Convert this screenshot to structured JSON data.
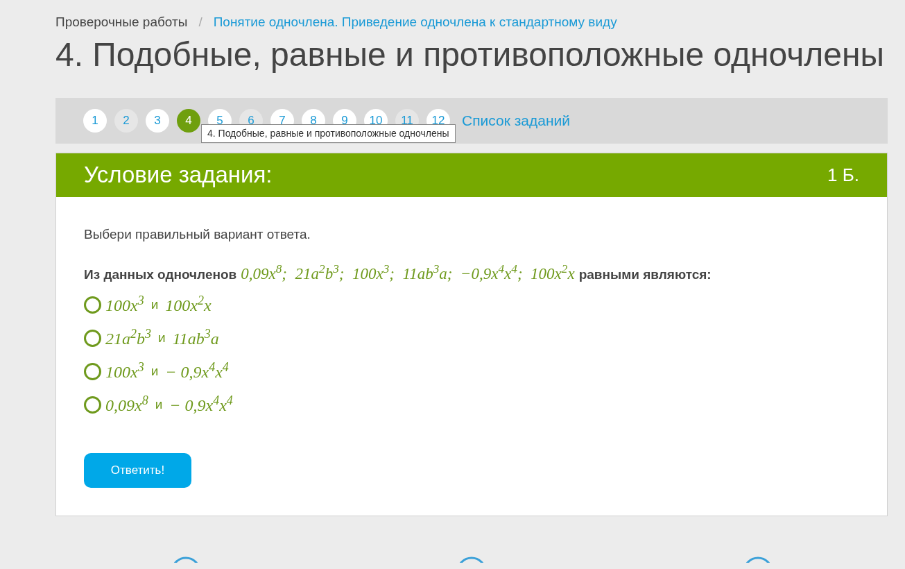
{
  "breadcrumb": [
    {
      "label": "Проверочные работы",
      "link": false
    },
    {
      "label": "Понятие одночлена. Приведение одночлена к стандартному виду",
      "link": true
    }
  ],
  "breadcrumb_separator": "/",
  "title": "4. Подобные, равные и противоположные одночлены",
  "pagination": {
    "pages": [
      {
        "label": "1",
        "selected": false,
        "visited": false
      },
      {
        "label": "2",
        "selected": false,
        "visited": true
      },
      {
        "label": "3",
        "selected": false,
        "visited": false
      },
      {
        "label": "4",
        "selected": true,
        "visited": false
      },
      {
        "label": "5",
        "selected": false,
        "visited": false
      },
      {
        "label": "6",
        "selected": false,
        "visited": true
      },
      {
        "label": "7",
        "selected": false,
        "visited": false
      },
      {
        "label": "8",
        "selected": false,
        "visited": false
      },
      {
        "label": "9",
        "selected": false,
        "visited": false
      },
      {
        "label": "10",
        "selected": false,
        "visited": false
      },
      {
        "label": "11",
        "selected": false,
        "visited": true
      },
      {
        "label": "12",
        "selected": false,
        "visited": false
      }
    ],
    "list_link": "Список заданий",
    "tooltip": "4. Подобные, равные и противоположные одночлены"
  },
  "task": {
    "header": "Условие задания:",
    "points": "1 Б.",
    "instruction": "Выбери правильный вариант ответа.",
    "question": {
      "lead": "Из данных одночленов",
      "formula": "0,09x$^{8}$;  21a$^{2}$b$^{3}$;  100x$^{3}$;  11ab$^{3}$a;  −0,9x$^{4}$x$^{4}$;  100x$^{2}$x",
      "tail": "равными являются:"
    },
    "options": [
      {
        "left": "100x$^{3}$",
        "joiner": "и",
        "right": "100x$^{2}$x",
        "selected": false
      },
      {
        "left": "21a$^{2}$b$^{3}$",
        "joiner": "и",
        "right": "11ab$^{3}$a",
        "selected": false
      },
      {
        "left": "100x$^{3}$",
        "joiner": "и",
        "right": "− 0,9x$^{4}$x$^{4}$",
        "selected": false
      },
      {
        "left": "0,09x$^{8}$",
        "joiner": "и",
        "right": "− 0,9x$^{4}$x$^{4}$",
        "selected": false
      }
    ],
    "submit": "Ответить!"
  }
}
